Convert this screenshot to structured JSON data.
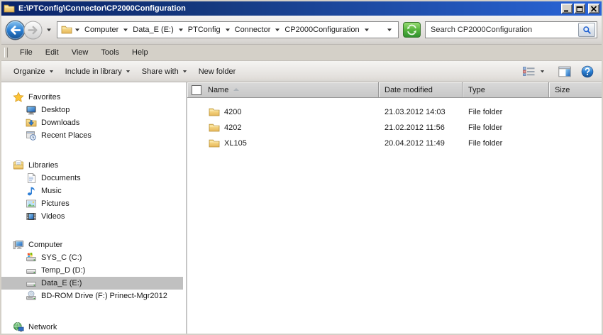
{
  "window": {
    "title": "E:\\PTConfig\\Connector\\CP2000Configuration",
    "icon": "folder-icon",
    "controls": [
      "minimize",
      "maximize",
      "close"
    ]
  },
  "address_bar": {
    "back": "back-button",
    "forward": "forward-button",
    "location_icon": "folder-icon",
    "breadcrumbs": [
      "Computer",
      "Data_E (E:)",
      "PTConfig",
      "Connector",
      "CP2000Configuration"
    ],
    "refresh": "refresh-button",
    "search_placeholder": "Search CP2000Configuration",
    "search_value": ""
  },
  "menu_bar": {
    "items": [
      "File",
      "Edit",
      "View",
      "Tools",
      "Help"
    ]
  },
  "toolbar": {
    "items": [
      "Organize",
      "Include in library",
      "Share with",
      "New folder"
    ],
    "right_buttons": [
      "views-button",
      "preview-pane-button",
      "help-button"
    ]
  },
  "columns": [
    "Name",
    "Date modified",
    "Type",
    "Size"
  ],
  "sort": {
    "column": "Name",
    "direction": "ascending"
  },
  "files": [
    {
      "icon": "folder",
      "name": "4200",
      "date_modified": "21.03.2012 14:03",
      "type": "File folder",
      "size": ""
    },
    {
      "icon": "folder",
      "name": "4202",
      "date_modified": "21.02.2012 11:56",
      "type": "File folder",
      "size": ""
    },
    {
      "icon": "folder",
      "name": "XL105",
      "date_modified": "20.04.2012 11:49",
      "type": "File folder",
      "size": ""
    }
  ],
  "sidebar": {
    "sections": [
      {
        "label": "Favorites",
        "icon": "star",
        "items": [
          {
            "label": "Desktop",
            "icon": "desktop"
          },
          {
            "label": "Downloads",
            "icon": "downloads"
          },
          {
            "label": "Recent Places",
            "icon": "recent-places"
          }
        ]
      },
      {
        "label": "Libraries",
        "icon": "libraries",
        "items": [
          {
            "label": "Documents",
            "icon": "documents"
          },
          {
            "label": "Music",
            "icon": "music"
          },
          {
            "label": "Pictures",
            "icon": "pictures"
          },
          {
            "label": "Videos",
            "icon": "videos"
          }
        ]
      },
      {
        "label": "Computer",
        "icon": "computer",
        "items": [
          {
            "label": "SYS_C (C:)",
            "icon": "system-drive",
            "selected": false
          },
          {
            "label": "Temp_D (D:)",
            "icon": "drive",
            "selected": false
          },
          {
            "label": "Data_E (E:)",
            "icon": "drive",
            "selected": true
          },
          {
            "label": "BD-ROM Drive (F:) Prinect-Mgr2012",
            "icon": "bd-rom-drive",
            "selected": false
          }
        ]
      },
      {
        "label": "Network",
        "icon": "network",
        "items": []
      }
    ]
  },
  "colors": {
    "titlebar_gradient_left": "#0a246a",
    "titlebar_gradient_right": "#2a65d8",
    "selected_item_background": "#c0c0c0",
    "refresh_button_green": "#4faf3f",
    "search_icon_blue": "#1e5fd0",
    "folder_icon_yellow": "#f0c85f"
  }
}
